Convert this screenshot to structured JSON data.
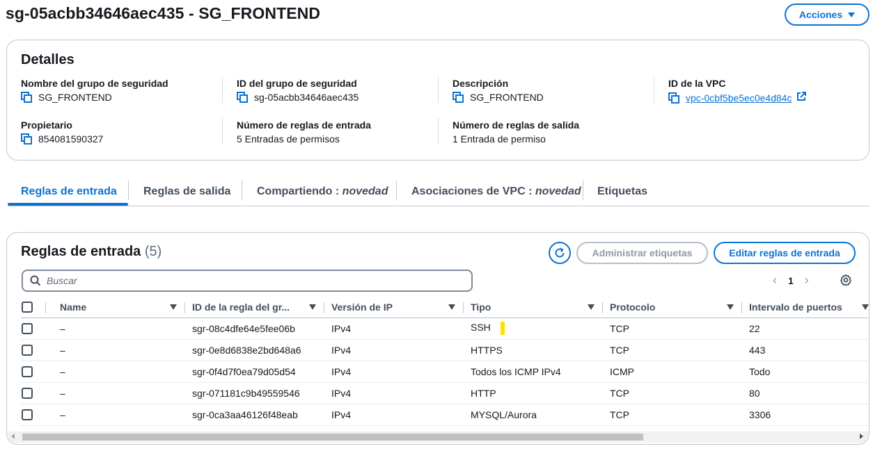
{
  "header": {
    "title": "sg-05acbb34646aec435 - SG_FRONTEND",
    "actions_label": "Acciones"
  },
  "details": {
    "title": "Detalles",
    "fields": [
      {
        "label": "Nombre del grupo de seguridad",
        "value": "SG_FRONTEND"
      },
      {
        "label": "ID del grupo de seguridad",
        "value": "sg-05acbb34646aec435"
      },
      {
        "label": "Descripción",
        "value": "SG_FRONTEND"
      },
      {
        "label": "ID de la VPC",
        "value": "vpc-0cbf5be5ec0e4d84c"
      },
      {
        "label": "Propietario",
        "value": "854081590327"
      },
      {
        "label": "Número de reglas de entrada",
        "value": "5 Entradas de permisos"
      },
      {
        "label": "Número de reglas de salida",
        "value": "1 Entrada de permiso"
      }
    ]
  },
  "tabs": [
    {
      "label": "Reglas de entrada",
      "suffix": ""
    },
    {
      "label": "Reglas de salida",
      "suffix": ""
    },
    {
      "label": "Compartiendo : ",
      "suffix": "novedad"
    },
    {
      "label": "Asociaciones de VPC : ",
      "suffix": "novedad"
    },
    {
      "label": "Etiquetas",
      "suffix": ""
    }
  ],
  "rules": {
    "title": "Reglas de entrada",
    "count": "(5)",
    "manage_tags_label": "Administrar etiquetas",
    "edit_rules_label": "Editar reglas de entrada",
    "search_placeholder": "Buscar",
    "page": "1",
    "columns": [
      "Name",
      "ID de la regla del gr...",
      "Versión de IP",
      "Tipo",
      "Protocolo",
      "Intervalo de puertos"
    ],
    "rows": [
      {
        "name": "–",
        "id": "sgr-08c4dfe64e5fee06b",
        "ip": "IPv4",
        "type": "SSH",
        "protocol": "TCP",
        "ports": "22"
      },
      {
        "name": "–",
        "id": "sgr-0e8d6838e2bd648a6",
        "ip": "IPv4",
        "type": "HTTPS",
        "protocol": "TCP",
        "ports": "443"
      },
      {
        "name": "–",
        "id": "sgr-0f4d7f0ea79d05d54",
        "ip": "IPv4",
        "type": "Todos los ICMP IPv4",
        "protocol": "ICMP",
        "ports": "Todo"
      },
      {
        "name": "–",
        "id": "sgr-071181c9b49559546",
        "ip": "IPv4",
        "type": "HTTP",
        "protocol": "TCP",
        "ports": "80"
      },
      {
        "name": "–",
        "id": "sgr-0ca3aa46126f48eab",
        "ip": "IPv4",
        "type": "MYSQL/Aurora",
        "protocol": "TCP",
        "ports": "3306"
      }
    ]
  },
  "colors": {
    "accent": "#0972d3",
    "text": "#16191f",
    "highlight": "#f9e400"
  }
}
